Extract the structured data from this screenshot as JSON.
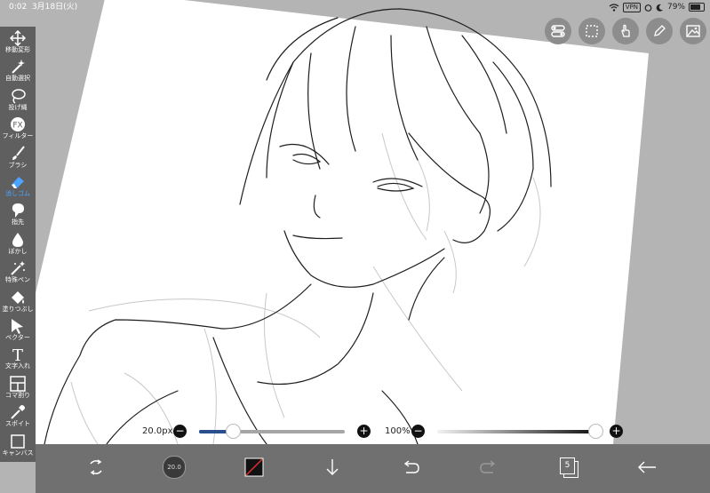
{
  "status": {
    "time": "0:02",
    "date": "3月18日(火)",
    "vpn": "VPN",
    "battery": "79%"
  },
  "tools": [
    {
      "label": "移動変形",
      "icon": "move-icon"
    },
    {
      "label": "自動選択",
      "icon": "magic-wand-icon"
    },
    {
      "label": "投げ縄",
      "icon": "lasso-icon"
    },
    {
      "label": "フィルター",
      "icon": "fx-icon",
      "glyph": "FX"
    },
    {
      "label": "ブラシ",
      "icon": "brush-icon"
    },
    {
      "label": "消しゴム",
      "icon": "eraser-icon",
      "active": true
    },
    {
      "label": "指先",
      "icon": "finger-icon"
    },
    {
      "label": "ぼかし",
      "icon": "blur-drop-icon"
    },
    {
      "label": "特殊ペン",
      "icon": "special-pen-icon"
    },
    {
      "label": "塗りつぶし",
      "icon": "fill-bucket-icon"
    },
    {
      "label": "ベクター",
      "icon": "vector-cursor-icon"
    },
    {
      "label": "文字入れ",
      "icon": "text-icon",
      "glyph": "T"
    },
    {
      "label": "コマ割り",
      "icon": "panel-divide-icon"
    },
    {
      "label": "スポイト",
      "icon": "eyedropper-icon"
    },
    {
      "label": "キャンバス",
      "icon": "canvas-icon"
    }
  ],
  "brush": {
    "size_label": "20.0px",
    "size_fraction": 0.23,
    "opacity_label": "100%",
    "opacity_fraction": 1.0,
    "minus": "−",
    "plus": "+"
  },
  "bottom": {
    "brush_preview": "20.0",
    "layer_count": "5"
  },
  "colors": {
    "accent": "#4aa3ff",
    "toolbar": "#5f5f5f",
    "bottombar": "#707070",
    "canvas_bg": "#b4b4b4",
    "size_track": "#2a4f8f"
  }
}
